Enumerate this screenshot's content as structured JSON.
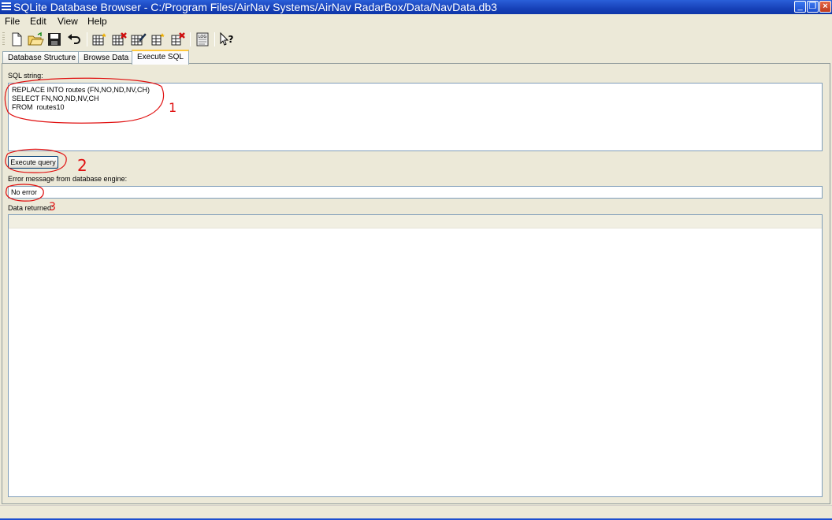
{
  "window": {
    "title": "SQLite Database Browser - C:/Program Files/AirNav Systems/AirNav RadarBox/Data/NavData.db3"
  },
  "menu": [
    "File",
    "Edit",
    "View",
    "Help"
  ],
  "toolbar": {
    "buttons": [
      "new-database-icon",
      "open-database-icon",
      "save-icon",
      "undo-icon",
      "create-table-icon",
      "delete-table-icon",
      "modify-table-icon",
      "create-index-icon",
      "delete-index-icon",
      "log-icon",
      "whats-this-icon"
    ],
    "log_glyph": "LOG"
  },
  "tabs": [
    {
      "label": "Database Structure",
      "active": false
    },
    {
      "label": "Browse Data",
      "active": false
    },
    {
      "label": "Execute SQL",
      "active": true
    }
  ],
  "execute_sql": {
    "sql_label": "SQL string:",
    "sql_lines": [
      "REPLACE INTO routes (FN,NO,ND,NV,CH)",
      "SELECT FN,NO,ND,NV,CH",
      "FROM  routes10"
    ],
    "execute_button": "Execute query",
    "error_label": "Error message from database engine:",
    "error_value": "No error",
    "data_label": "Data returned:"
  },
  "annotations": {
    "color": "#e01010",
    "marks": [
      "1",
      "2",
      "3"
    ]
  }
}
